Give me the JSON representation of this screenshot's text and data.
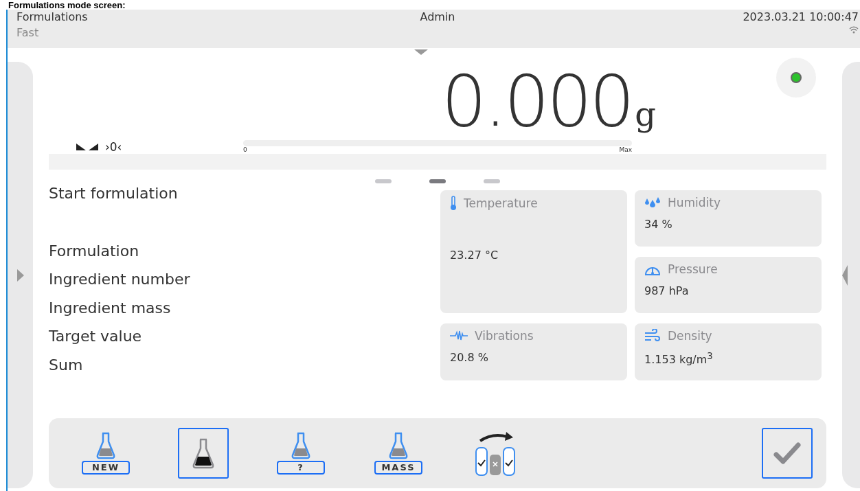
{
  "caption": "Formulations mode screen:",
  "header": {
    "title": "Formulations",
    "mode": "Fast",
    "user": "Admin",
    "datetime": "2023.03.21 10:00:47"
  },
  "weight": {
    "value": "0.000",
    "unit": "g",
    "zero_marker": "›0‹",
    "bar_min": "0",
    "bar_max": "Max",
    "level": 0,
    "stable": true
  },
  "pages": [
    {
      "selected": false
    },
    {
      "selected": true
    },
    {
      "selected": false
    }
  ],
  "info": [
    {
      "label": "Start formulation"
    },
    {
      "label": "Formulation"
    },
    {
      "label": "Ingredient number"
    },
    {
      "label": "Ingredient mass"
    },
    {
      "label": "Target value"
    },
    {
      "label": "Sum"
    }
  ],
  "cards": [
    {
      "kind": "temperature",
      "label": "Temperature",
      "value": "23.27 °C"
    },
    {
      "kind": "humidity",
      "label": "Humidity",
      "value": "34 %"
    },
    {
      "kind": "pressure",
      "label": "Pressure",
      "value": "987 hPa"
    },
    {
      "kind": "vibrations",
      "label": "Vibrations",
      "value": "20.8 %"
    },
    {
      "kind": "density",
      "label": "Density",
      "value": "1.153 kg/m$^{3}$"
    }
  ],
  "toolbar": [
    {
      "kind": "flask-label",
      "label": "NEW",
      "selected": false
    },
    {
      "kind": "flask-dark",
      "selected": true
    },
    {
      "kind": "flask-label",
      "label": "?",
      "selected": false
    },
    {
      "kind": "flask-label",
      "label": "MASS",
      "selected": false
    },
    {
      "kind": "containers",
      "selected": false
    }
  ]
}
